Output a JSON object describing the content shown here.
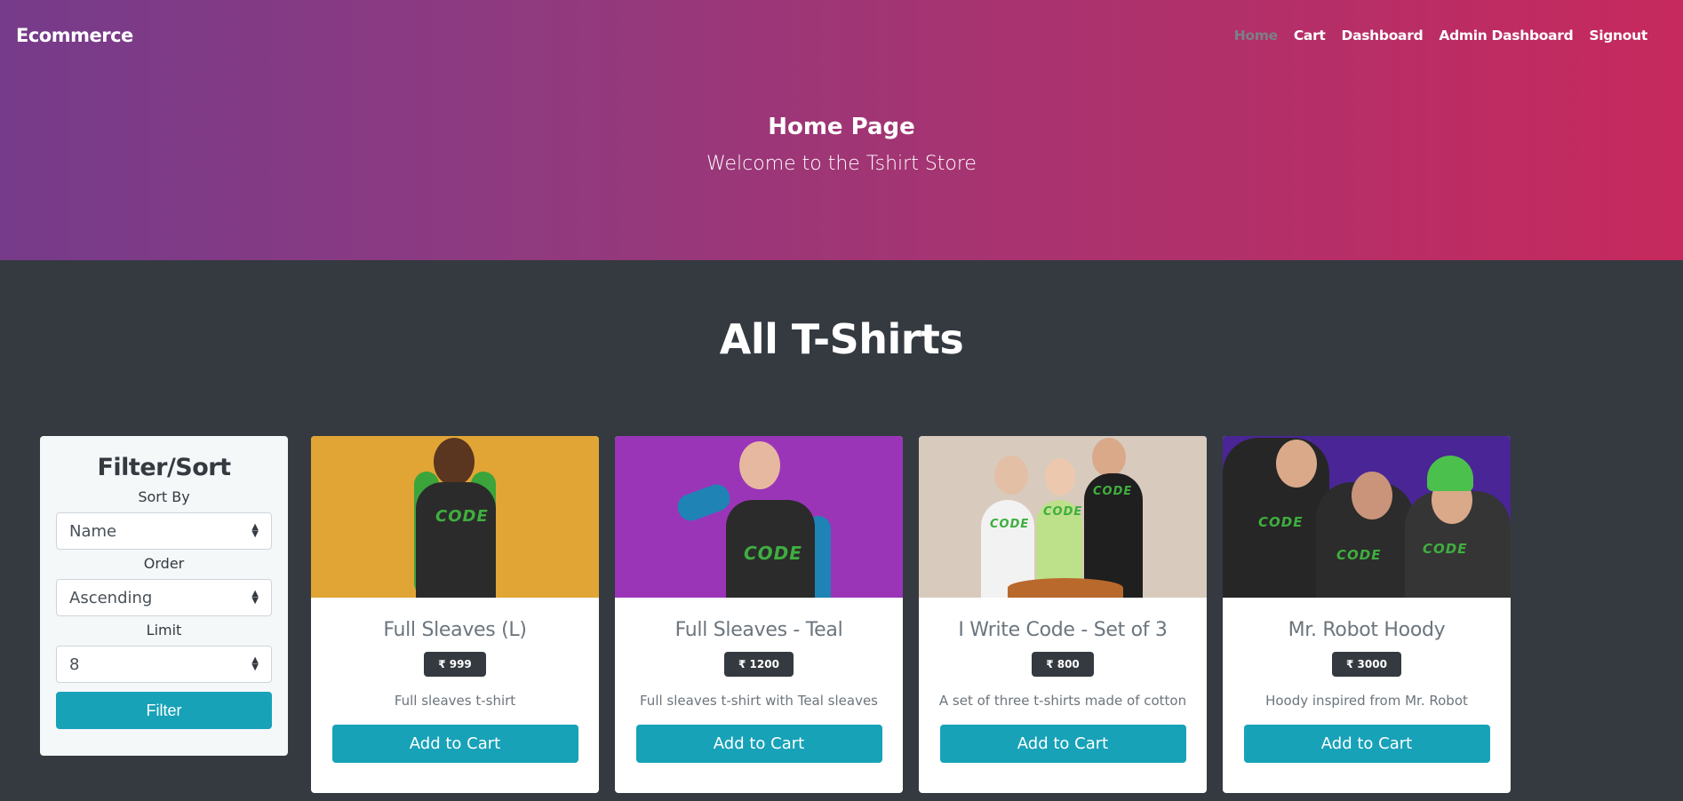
{
  "navbar": {
    "brand": "Ecommerce",
    "links": [
      {
        "label": "Home",
        "active": true
      },
      {
        "label": "Cart",
        "active": false
      },
      {
        "label": "Dashboard",
        "active": false
      },
      {
        "label": "Admin Dashboard",
        "active": false
      },
      {
        "label": "Signout",
        "active": false
      }
    ]
  },
  "hero": {
    "title": "Home Page",
    "subtitle": "Welcome to the Tshirt Store"
  },
  "section_title": "All T-Shirts",
  "filter": {
    "title": "Filter/Sort",
    "sort_by_label": "Sort By",
    "sort_by_value": "Name",
    "order_label": "Order",
    "order_value": "Ascending",
    "limit_label": "Limit",
    "limit_value": "8",
    "button_label": "Filter"
  },
  "products": [
    {
      "name": "Full Sleaves (L)",
      "price": "₹ 999",
      "description": "Full sleaves t-shirt",
      "button": "Add to Cart",
      "image": "man-green-sleeves-yellow-bg"
    },
    {
      "name": "Full Sleaves - Teal",
      "price": "₹ 1200",
      "description": "Full sleaves t-shirt with Teal sleaves",
      "button": "Add to Cart",
      "image": "woman-teal-sleeves-purple-bg"
    },
    {
      "name": "I Write Code - Set of 3",
      "price": "₹ 800",
      "description": "A set of three t-shirts made of cotton",
      "button": "Add to Cart",
      "image": "family-three-tshirts"
    },
    {
      "name": "Mr. Robot Hoody",
      "price": "₹ 3000",
      "description": "Hoody inspired from Mr. Robot",
      "button": "Add to Cart",
      "image": "three-people-hoodies-purple-bg"
    }
  ],
  "colors": {
    "accent": "#17a2b8",
    "dark": "#343a40",
    "gradient_start": "#763b8a",
    "gradient_end": "#c6295d",
    "nav_active": "#7c7f86"
  }
}
